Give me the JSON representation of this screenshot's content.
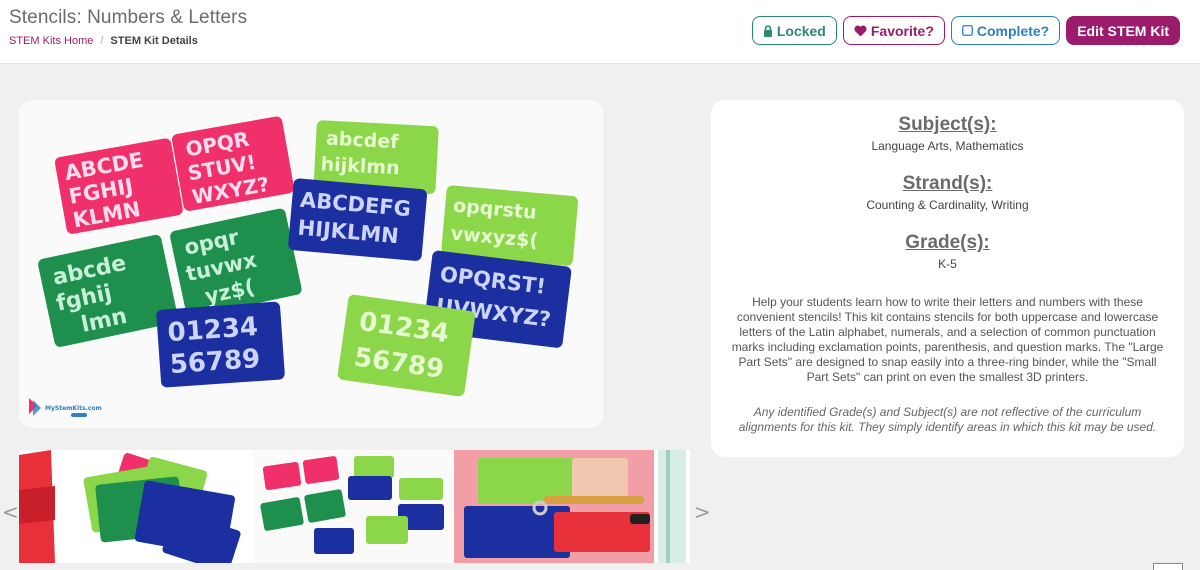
{
  "header": {
    "title": "Stencils: Numbers & Letters",
    "breadcrumb": [
      {
        "label": "STEM Kits Home"
      },
      {
        "label": "STEM Kit Details"
      }
    ],
    "buttons": {
      "locked": "Locked",
      "favorite": "Favorite?",
      "complete": "Complete?",
      "edit": "Edit STEM Kit"
    }
  },
  "main_image": {
    "stencil_texts": {
      "upper1": [
        "ABCDE",
        "FGHIJ",
        "KLMN"
      ],
      "upper2": [
        "OPQR",
        "STUV!",
        "WXYZ?"
      ],
      "lower1": [
        "abcde",
        "fghij",
        "lmn"
      ],
      "lower2": [
        "opqr",
        "tuvwx",
        "yz$("
      ],
      "green_lower": [
        "abcdef",
        "hijklmn"
      ],
      "blue_upper": [
        "ABCDEFG",
        "HIJKLMN"
      ],
      "green_lower2": [
        "opqrstu",
        "vwxyz$("
      ],
      "blue_upper2": [
        "OPQRST!",
        "UVWXYZ?"
      ],
      "blue_nums": [
        "01234",
        "56789"
      ],
      "green_nums": [
        "01234",
        "56789"
      ]
    },
    "watermark": "MyStemKits.com"
  },
  "info": {
    "subject_heading": "Subject(s):",
    "subject_value": "Language Arts, Mathematics",
    "strand_heading": "Strand(s):",
    "strand_value": "Counting & Cardinality, Writing",
    "grade_heading": "Grade(s):",
    "grade_value": "K-5",
    "description": "Help your students learn how to write their letters and numbers with these convenient stencils! This kit contains stencils for both uppercase and lowercase letters of the Latin alphabet, numerals, and a selection of common punctuation marks including exclamation points, parenthesis, and question marks. The \"Large Part Sets\" are designed to snap easily into a three-ring binder, while the \"Small Part Sets\" can print on even the smallest 3D printers.",
    "disclaimer": "Any identified Grade(s) and Subject(s) are not reflective of the curriculum alignments for this kit. They simply identify areas in which this kit may be used."
  },
  "thumbnails": {
    "prev_arrow": "<",
    "next_arrow": ">"
  },
  "colors": {
    "brand": "#9c1c6c",
    "locked": "#2a8a6f",
    "complete": "#2f7fbf",
    "pink": "#f0306a",
    "green": "#1f8f4e",
    "lime": "#8cd64a",
    "blue": "#1c2fa0"
  }
}
